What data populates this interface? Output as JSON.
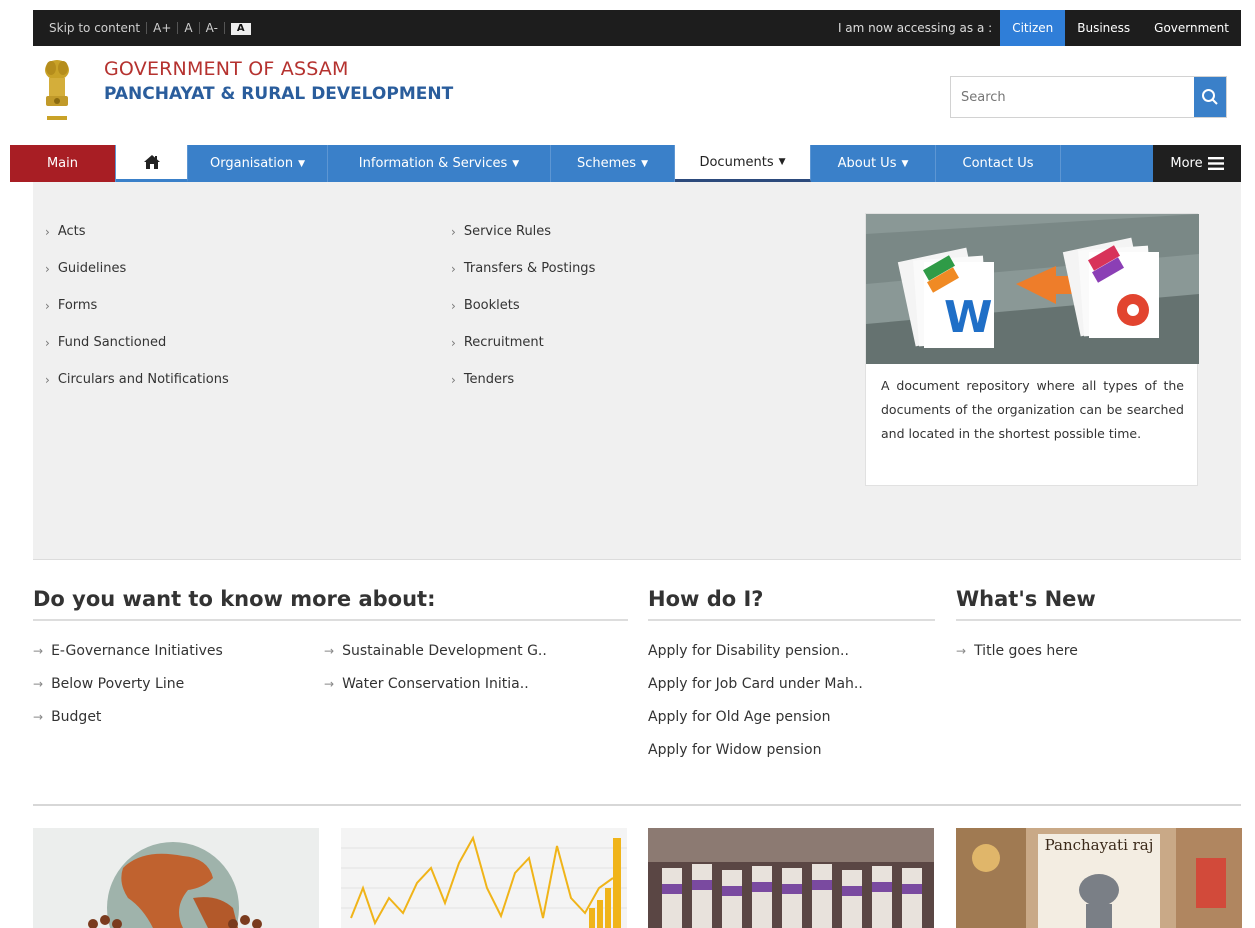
{
  "topbar": {
    "skip": "Skip to content",
    "font_large": "A+",
    "font_normal": "A",
    "font_small": "A-",
    "contrast": "A",
    "access_label": "I am now accessing as a :",
    "roles": [
      "Citizen",
      "Business",
      "Government"
    ]
  },
  "header": {
    "org_line1": "GOVERNMENT OF ASSAM",
    "org_line2": "PANCHAYAT & RURAL DEVELOPMENT",
    "search_placeholder": "Search"
  },
  "nav": {
    "items": [
      "Main",
      "Organisation",
      "Information & Services",
      "Schemes",
      "Documents",
      "About Us",
      "Contact Us"
    ],
    "more": "More"
  },
  "documents_menu": {
    "col1": [
      "Acts",
      "Guidelines",
      "Forms",
      "Fund Sanctioned",
      "Circulars and Notifications"
    ],
    "col2": [
      "Service Rules",
      "Transfers & Postings",
      "Booklets",
      "Recruitment",
      "Tenders"
    ],
    "card_text": "A document repository where all types of the documents of the organization can be searched and located in the shortest possible time."
  },
  "know_more": {
    "title": "Do you want to know more about:",
    "col1": [
      "E-Governance Initiatives",
      "Below Poverty Line",
      "Budget"
    ],
    "col2": [
      "Sustainable Development G..",
      "Water Conservation Initia.."
    ]
  },
  "how_do_i": {
    "title": "How do I?",
    "items": [
      "Apply for Disability pension..",
      "Apply for Job Card under Mah..",
      "Apply for Old Age pension",
      "Apply for Widow pension"
    ]
  },
  "whats_new": {
    "title": "What's New",
    "items": [
      "Title goes here"
    ]
  },
  "thumbs": {
    "panchayati_caption": "Panchayati raj"
  },
  "colors": {
    "nav_blue": "#3a80c9",
    "main_red": "#a81e24",
    "org_red": "#b5322f",
    "org_blue": "#2a5d9c"
  }
}
